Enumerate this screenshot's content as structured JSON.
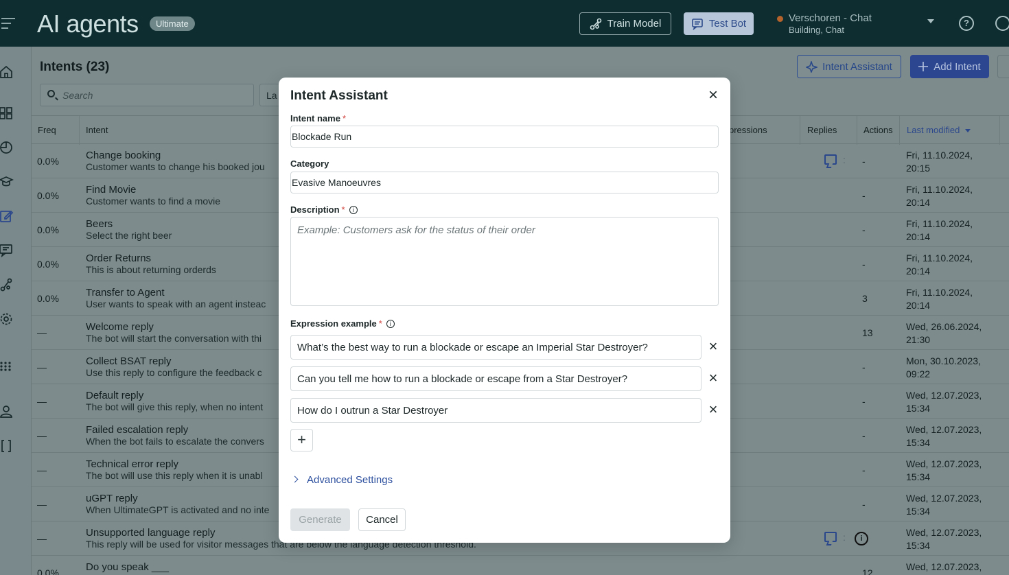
{
  "header": {
    "app_title": "AI agents",
    "plan_badge": "Ultimate",
    "train_label": "Train Model",
    "test_label": "Test Bot",
    "account_name": "Verschoren - Chat",
    "account_status": "Building, Chat"
  },
  "page": {
    "title": "Intents (23)",
    "search_placeholder": "Search",
    "language_filter": "La",
    "intent_assistant_label": "Intent Assistant",
    "add_intent_label": "Add Intent"
  },
  "table": {
    "headers": {
      "freq": "Freq",
      "intent": "Intent",
      "expressions": "pressions",
      "replies": "Replies",
      "actions": "Actions",
      "last_modified": "Last modified"
    },
    "rows": [
      {
        "freq": "0.0%",
        "title": "Change booking",
        "desc": "Customer wants to change his booked jou",
        "actions": "-",
        "mod1": "Fri, 11.10.2024,",
        "mod2": "20:15"
      },
      {
        "freq": "0.0%",
        "title": "Find Movie",
        "desc": "Customer wants to find a movie",
        "actions": "-",
        "mod1": "Fri, 11.10.2024,",
        "mod2": "20:14"
      },
      {
        "freq": "0.0%",
        "title": "Beers",
        "desc": "Select the right beer",
        "actions": "-",
        "mod1": "Fri, 11.10.2024,",
        "mod2": "20:14"
      },
      {
        "freq": "0.0%",
        "title": "Order Returns",
        "desc": "This is about returning orderds",
        "actions": "-",
        "mod1": "Fri, 11.10.2024,",
        "mod2": "20:14"
      },
      {
        "freq": "0.0%",
        "title": "Transfer to Agent",
        "desc": "User wants to speak with an agent insteac",
        "actions": "3",
        "mod1": "Fri, 11.10.2024,",
        "mod2": "20:14"
      },
      {
        "freq": "—",
        "title": "Welcome reply",
        "desc": "The bot will start the conversation with thi",
        "actions": "13",
        "mod1": "Wed, 26.06.2024,",
        "mod2": "21:30"
      },
      {
        "freq": "—",
        "title": "Collect BSAT reply",
        "desc": "Use this reply to configure the feedback c",
        "actions": "-",
        "mod1": "Mon, 30.10.2023,",
        "mod2": "09:22"
      },
      {
        "freq": "—",
        "title": "Default reply",
        "desc": "The bot will give this reply, when no intent",
        "actions": "-",
        "mod1": "Wed, 12.07.2023,",
        "mod2": "15:34"
      },
      {
        "freq": "—",
        "title": "Failed escalation reply",
        "desc": "When the bot fails to escalate the convers",
        "actions": "-",
        "mod1": "Wed, 12.07.2023,",
        "mod2": "15:34"
      },
      {
        "freq": "—",
        "title": "Technical error reply",
        "desc": "The bot will use this reply when it is unabl",
        "actions": "-",
        "mod1": "Wed, 12.07.2023,",
        "mod2": "15:34"
      },
      {
        "freq": "—",
        "title": "uGPT reply",
        "desc": "When UltimateGPT is activated and no inte",
        "actions": "-",
        "mod1": "Wed, 12.07.2023,",
        "mod2": "15:34"
      },
      {
        "freq": "—",
        "title": "Unsupported language reply",
        "desc": "This reply will be used for visitor messages that are below the language detection threshold.",
        "actions": "",
        "mod1": "Wed, 12.07.2023,",
        "mod2": "15:34"
      },
      {
        "freq": "0.0%",
        "title": "Do you speak ___",
        "desc": "",
        "actions": "12",
        "mod1": "Wed, 12.07.2023,",
        "mod2": ""
      }
    ]
  },
  "modal": {
    "title": "Intent Assistant",
    "intent_name_label": "Intent name",
    "intent_name_value": "Blockade Run",
    "category_label": "Category",
    "category_value": "Evasive Manoeuvres",
    "description_label": "Description",
    "description_placeholder": "Example: Customers ask for the status of their order",
    "expression_label": "Expression example",
    "required_mark": "*",
    "info_mark": "i",
    "expressions": [
      "What’s the best way to run a blockade or escape an Imperial Star Destroyer?",
      "Can you tell me how to run a blockade or escape from a Star Destroyer?",
      "How do I outrun a Star Destroyer"
    ],
    "add_glyph": "+",
    "remove_glyph": "×",
    "advanced_label": "Advanced Settings",
    "generate_label": "Generate",
    "cancel_label": "Cancel"
  }
}
